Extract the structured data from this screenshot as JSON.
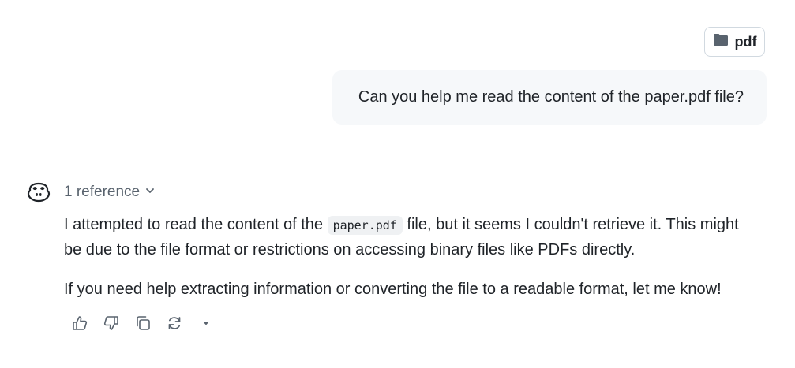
{
  "attachment": {
    "label": "pdf",
    "icon": "folder-icon"
  },
  "user_message": {
    "text": "Can you help me read the content of the paper.pdf file?"
  },
  "assistant": {
    "avatar_icon": "copilot-icon",
    "references_label": "1 reference",
    "answer": {
      "p1_before": "I attempted to read the content of the ",
      "p1_code": "paper.pdf",
      "p1_after": " file, but it seems I couldn't retrieve it. This might be due to the file format or restrictions on accessing binary files like PDFs directly.",
      "p2": "If you need help extracting information or converting the file to a readable format, let me know!"
    },
    "actions": [
      {
        "name": "thumbs-up-icon"
      },
      {
        "name": "thumbs-down-icon"
      },
      {
        "name": "copy-icon"
      },
      {
        "name": "retry-icon"
      },
      {
        "name": "caret-down-icon"
      }
    ]
  },
  "colors": {
    "bubble": "#f6f8fa",
    "text": "#1f2328",
    "muted": "#59636e",
    "border": "#d1d9e0"
  }
}
